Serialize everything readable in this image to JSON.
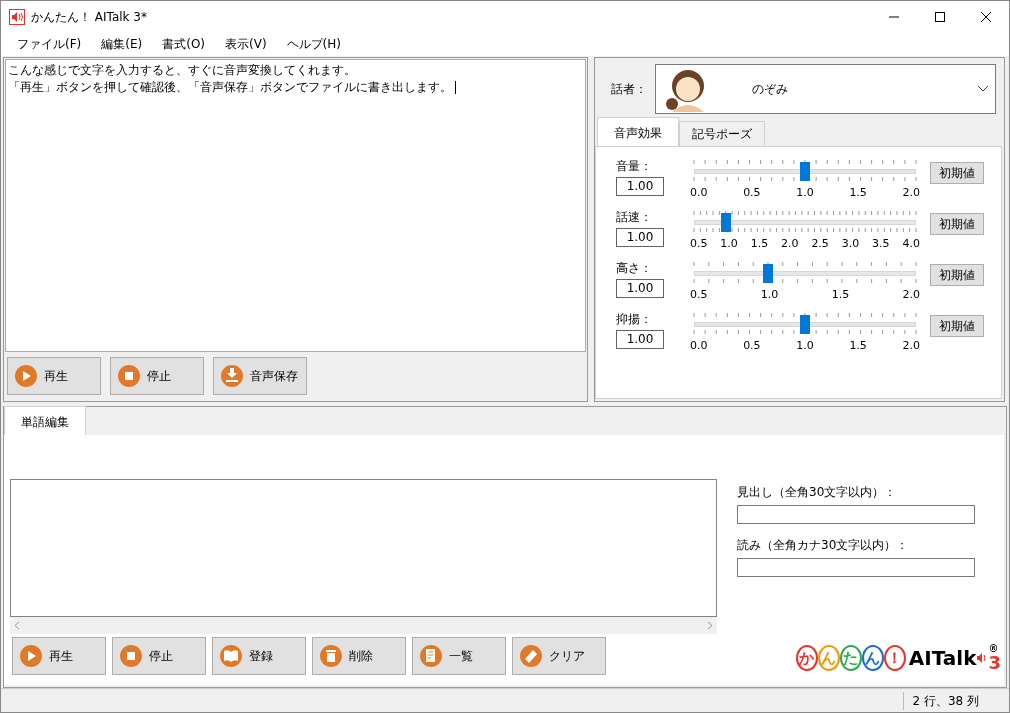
{
  "window": {
    "title": "かんたん！ AITalk 3*"
  },
  "menu": [
    {
      "label": "ファイル(F)"
    },
    {
      "label": "編集(E)"
    },
    {
      "label": "書式(O)"
    },
    {
      "label": "表示(V)"
    },
    {
      "label": "ヘルプ(H)"
    }
  ],
  "editor": {
    "lines": [
      "こんな感じで文字を入力すると、すぐに音声変換してくれます。",
      "「再生」ボタンを押して確認後、「音声保存」ボタンでファイルに書き出します。"
    ]
  },
  "editor_buttons": [
    {
      "label": "再生",
      "kind": "play"
    },
    {
      "label": "停止",
      "kind": "stop"
    },
    {
      "label": "音声保存",
      "kind": "save"
    }
  ],
  "speaker": {
    "label": "話者：",
    "name": "のぞみ"
  },
  "tabs": [
    {
      "label": "音声効果",
      "selected": true
    },
    {
      "label": "記号ポーズ",
      "selected": false
    }
  ],
  "sliders": [
    {
      "label": "音量：",
      "value": "1.00",
      "level": 0.5,
      "scale": [
        "0.0",
        "0.5",
        "1.0",
        "1.5",
        "2.0"
      ],
      "reset": "初期値"
    },
    {
      "label": "話速：",
      "value": "1.00",
      "level": 0.143,
      "scale": [
        "0.5",
        "1.0",
        "1.5",
        "2.0",
        "2.5",
        "3.0",
        "3.5",
        "4.0"
      ],
      "reset": "初期値"
    },
    {
      "label": "高さ：",
      "value": "1.00",
      "level": 0.333,
      "scale": [
        "0.5",
        "1.0",
        "1.5",
        "2.0"
      ],
      "reset": "初期値"
    },
    {
      "label": "抑揚：",
      "value": "1.00",
      "level": 0.5,
      "scale": [
        "0.0",
        "0.5",
        "1.0",
        "1.5",
        "2.0"
      ],
      "reset": "初期値"
    }
  ],
  "word_tabs": [
    {
      "label": "単語編集",
      "selected": true
    }
  ],
  "word_fields": [
    {
      "label": "見出し（全角30文字以内）："
    },
    {
      "label": "読み（全角カナ30文字以内）："
    }
  ],
  "word_buttons": [
    {
      "label": "再生",
      "kind": "play"
    },
    {
      "label": "停止",
      "kind": "stop"
    },
    {
      "label": "登録",
      "kind": "register"
    },
    {
      "label": "削除",
      "kind": "delete"
    },
    {
      "label": "一覧",
      "kind": "list"
    },
    {
      "label": "クリア",
      "kind": "clear"
    }
  ],
  "logo": {
    "chars": [
      {
        "text": "か",
        "color": "#e8342c"
      },
      {
        "text": "ん",
        "color": "#f39800"
      },
      {
        "text": "た",
        "color": "#2fa84f"
      },
      {
        "text": "ん",
        "color": "#1d6fc9"
      },
      {
        "text": "！",
        "color": "#e8342c"
      }
    ],
    "name": "AITalk",
    "mark": "®",
    "version": "3"
  },
  "status_bar": {
    "position": "2 行、38 列"
  }
}
